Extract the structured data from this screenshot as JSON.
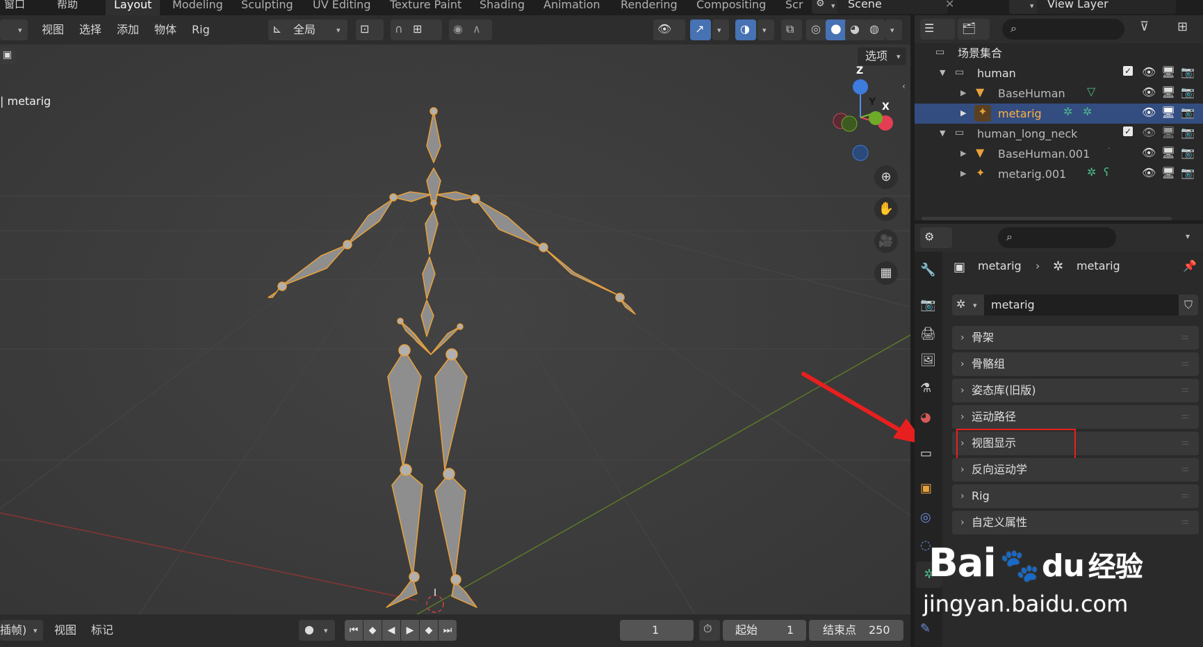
{
  "top_menu": {
    "items": [
      "窗口",
      "帮助"
    ]
  },
  "workspaces": [
    "Layout",
    "Modeling",
    "Sculpting",
    "UV Editing",
    "Texture Paint",
    "Shading",
    "Animation",
    "Rendering",
    "Compositing",
    "Scr"
  ],
  "scene": {
    "name": "Scene"
  },
  "view_layer": {
    "name": "View Layer"
  },
  "viewport": {
    "menu": [
      "视图",
      "选择",
      "添加",
      "物体",
      "Rig"
    ],
    "transform_orientation": "全局",
    "options_label": "选项",
    "active_object_label": "| metarig",
    "gizmo": {
      "z": "Z",
      "y": "Y",
      "x": "X"
    }
  },
  "outliner": {
    "root_label": "场景集合",
    "rows": [
      {
        "name": "human",
        "type": "collection"
      },
      {
        "name": "BaseHuman",
        "type": "mesh"
      },
      {
        "name": "metarig",
        "type": "armature",
        "selected": true
      },
      {
        "name": "human_long_neck",
        "type": "collection"
      },
      {
        "name": "BaseHuman.001",
        "type": "mesh"
      },
      {
        "name": "metarig.001",
        "type": "armature"
      }
    ]
  },
  "properties": {
    "breadcrumb_object": "metarig",
    "breadcrumb_data": "metarig",
    "datablock_name": "metarig",
    "panels": [
      "骨架",
      "骨骼组",
      "姿态库(旧版)",
      "运动路径",
      "视图显示",
      "反向运动学",
      "Rig",
      "自定义属性"
    ],
    "highlighted_panel": "视图显示"
  },
  "timeline": {
    "mode_label": "插帧)",
    "menu": [
      "视图",
      "标记"
    ],
    "current_frame": "1",
    "start_label": "起始",
    "start_value": "1",
    "end_label": "结束点",
    "end_value": "250"
  },
  "watermark": {
    "brand": "Bai",
    "brand_tail": "经验",
    "url": "jingyan.baidu.com"
  },
  "colors": {
    "accent_blue": "#4772b3",
    "bone_orange": "#e8a13c",
    "annotation_red": "#e81f1f",
    "selected_row": "#334d80"
  }
}
